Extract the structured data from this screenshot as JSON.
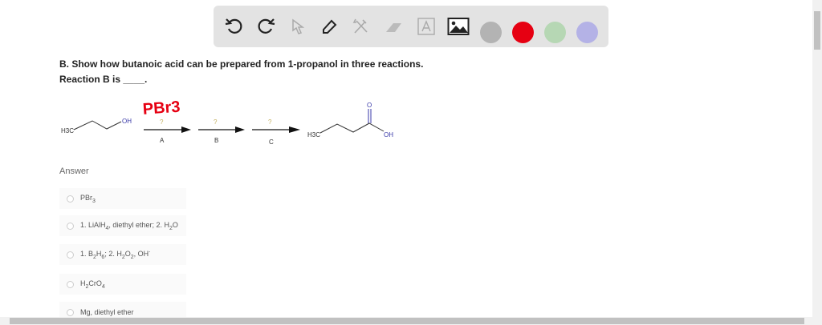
{
  "toolbar": {
    "tools": [
      "undo-icon",
      "redo-icon",
      "select-icon",
      "pen-icon",
      "tools-icon",
      "eraser-icon",
      "text-icon",
      "image-icon"
    ],
    "colors": [
      "#b3b3b3",
      "#e60012",
      "#b6d7b4",
      "#b4b2e6"
    ]
  },
  "question": {
    "line1": "B. Show how butanoic acid can be prepared from 1-propanol in three reactions.",
    "line2": "Reaction B is ____."
  },
  "scheme": {
    "reactant_h3c": "H3C",
    "reactant_oh": "OH",
    "handwritten": "PBr3",
    "q": "?",
    "labels": [
      "A",
      "B",
      "C"
    ],
    "product_h3c": "H3C",
    "product_o": "O",
    "product_oh": "OH"
  },
  "answer": {
    "label": "Answer",
    "options": [
      "PBr3",
      "1. LiAlH4, diethyl ether; 2. H2O",
      "1. B2H6; 2. H2O2, OH-",
      "H2CrO4",
      "Mg, diethyl ether"
    ]
  }
}
